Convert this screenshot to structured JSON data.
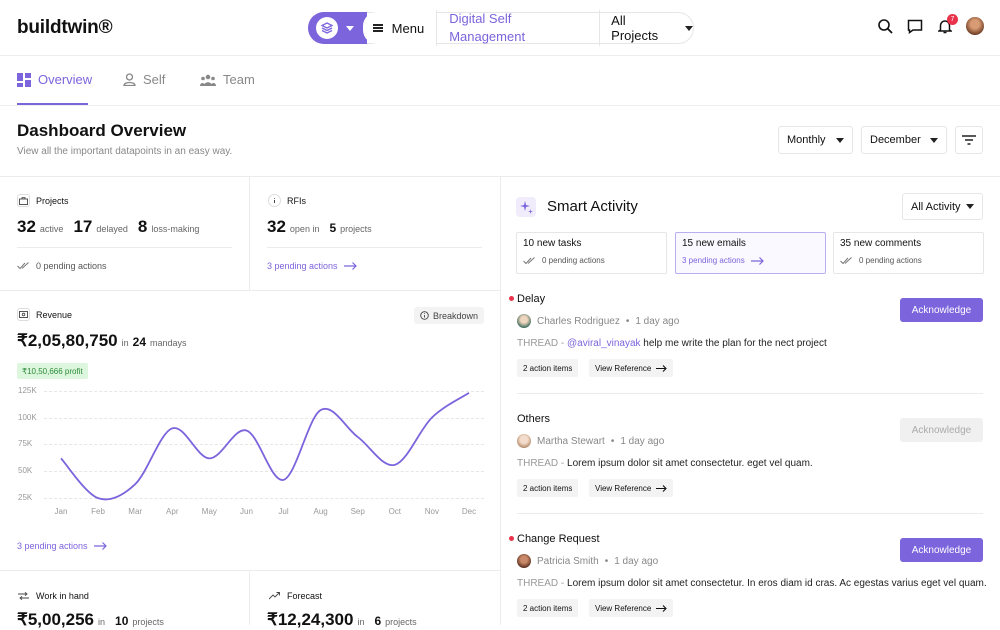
{
  "header": {
    "logo": "buildtwin®",
    "menu_label": "Menu",
    "module": "Digital Self Management",
    "project_select": "All Projects",
    "notif_count": "7"
  },
  "tabs": [
    {
      "label": "Overview"
    },
    {
      "label": "Self"
    },
    {
      "label": "Team"
    }
  ],
  "page": {
    "title": "Dashboard Overview",
    "subtitle": "View all the important datapoints in an easy way.",
    "period": "Monthly",
    "month": "December"
  },
  "projects": {
    "label": "Projects",
    "active": "32",
    "active_lbl": "active",
    "delayed": "17",
    "delayed_lbl": "delayed",
    "loss": "8",
    "loss_lbl": "loss-making",
    "pending": "0 pending actions"
  },
  "rfis": {
    "label": "RFIs",
    "open": "32",
    "open_lbl": "open in",
    "projects": "5",
    "projects_lbl": "projects",
    "pending": "3 pending actions"
  },
  "revenue": {
    "label": "Revenue",
    "breakdown": "Breakdown",
    "amount": "₹2,05,80,750",
    "in": "in",
    "mandays": "24",
    "mandays_lbl": "mandays",
    "profit": "₹10,50,666 profit",
    "pending": "3 pending actions"
  },
  "chart_data": {
    "type": "line",
    "x": [
      "Jan",
      "Feb",
      "Mar",
      "Apr",
      "May",
      "Jun",
      "Jul",
      "Aug",
      "Sep",
      "Oct",
      "Nov",
      "Dec"
    ],
    "ytick_labels": [
      "25K",
      "50K",
      "75K",
      "100K",
      "125K"
    ],
    "ylim": [
      0,
      135000
    ],
    "series": [
      {
        "values": [
          62000,
          25000,
          38000,
          90000,
          62000,
          88000,
          42000,
          107000,
          82000,
          56000,
          100000,
          123000
        ]
      }
    ],
    "color": "#7c64dc"
  },
  "work": {
    "label": "Work in hand",
    "amount": "₹5,00,256",
    "in": "in",
    "projects": "10",
    "projects_lbl": "projects"
  },
  "forecast": {
    "label": "Forecast",
    "amount": "₹12,24,300",
    "in": "in",
    "projects": "6",
    "projects_lbl": "projects"
  },
  "smart": {
    "title": "Smart Activity",
    "filter": "All Activity",
    "cards": [
      {
        "title": "10 new tasks",
        "pending": "0 pending actions"
      },
      {
        "title": "15 new emails",
        "pending": "3 pending actions"
      },
      {
        "title": "35 new comments",
        "pending": "0 pending actions"
      }
    ],
    "items": [
      {
        "title": "Delay",
        "who": "Charles Rodriguez",
        "time": "1 day ago",
        "thread_lbl": "THREAD -",
        "mention": "@aviral_vinayak",
        "text": " help me write the plan for the nect project",
        "chip1": "2 action items",
        "chip2": "View Reference",
        "ack": "Acknowledge"
      },
      {
        "title": "Others",
        "who": "Martha Stewart",
        "time": "1 day ago",
        "thread_lbl": "THREAD -",
        "mention": "",
        "text": " Lorem ipsum dolor sit amet consectetur. eget vel quam.",
        "chip1": "2 action items",
        "chip2": "View Reference",
        "ack": "Acknowledge"
      },
      {
        "title": "Change Request",
        "who": "Patricia Smith",
        "time": "1 day ago",
        "thread_lbl": "THREAD -",
        "mention": "",
        "text": " Lorem ipsum dolor sit amet consectetur. In eros diam id cras. Ac egestas varius eget vel quam.",
        "chip1": "2 action items",
        "chip2": "View Reference",
        "ack": "Acknowledge"
      }
    ]
  }
}
